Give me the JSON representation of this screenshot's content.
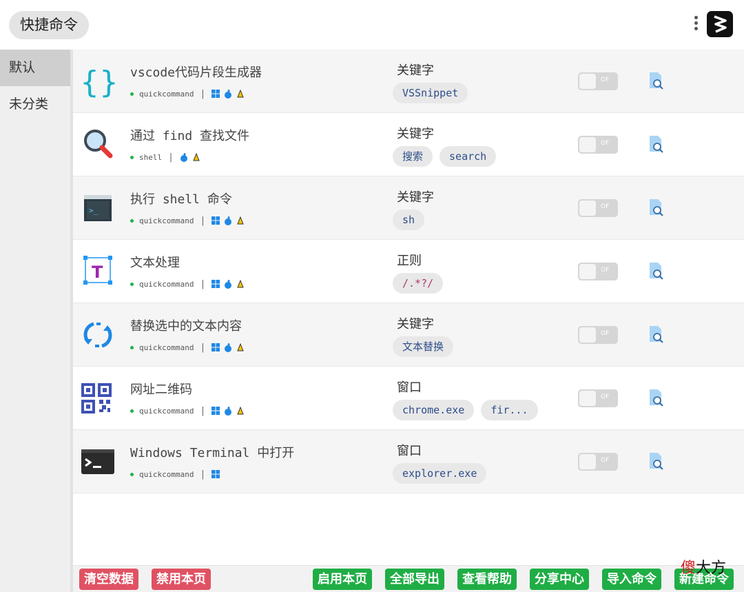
{
  "header": {
    "title": "快捷命令"
  },
  "sidebar": {
    "items": [
      {
        "label": "默认"
      },
      {
        "label": "未分类"
      }
    ]
  },
  "commands": [
    {
      "name": "vscode代码片段生成器",
      "source": "quickcommand",
      "platforms": [
        "windows",
        "apple",
        "linux"
      ],
      "icon": "braces-icon",
      "kw_label": "关键字",
      "tags": [
        "VSSnippet"
      ],
      "toggle": "OF"
    },
    {
      "name": "通过 find 查找文件",
      "source": "shell",
      "platforms": [
        "apple",
        "linux"
      ],
      "icon": "magnifier-icon",
      "kw_label": "关键字",
      "tags": [
        "搜索",
        "search"
      ],
      "toggle": "OF"
    },
    {
      "name": "执行 shell 命令",
      "source": "quickcommand",
      "platforms": [
        "windows",
        "apple",
        "linux"
      ],
      "icon": "terminal-window-icon",
      "kw_label": "关键字",
      "tags": [
        "sh"
      ],
      "toggle": "OF"
    },
    {
      "name": "文本处理",
      "source": "quickcommand",
      "platforms": [
        "windows",
        "apple",
        "linux"
      ],
      "icon": "text-box-icon",
      "kw_label": "正则",
      "tags": [
        "/.*?/"
      ],
      "toggle": "OF"
    },
    {
      "name": "替换选中的文本内容",
      "source": "quickcommand",
      "platforms": [
        "windows",
        "apple",
        "linux"
      ],
      "icon": "replace-arrows-icon",
      "kw_label": "关键字",
      "tags": [
        "文本替换"
      ],
      "toggle": "OF"
    },
    {
      "name": "网址二维码",
      "source": "quickcommand",
      "platforms": [
        "windows",
        "apple",
        "linux"
      ],
      "icon": "qr-code-icon",
      "kw_label": "窗口",
      "tags": [
        "chrome.exe",
        "fir..."
      ],
      "toggle": "OF"
    },
    {
      "name": "Windows Terminal 中打开",
      "source": "quickcommand",
      "platforms": [
        "windows"
      ],
      "icon": "terminal-prompt-icon",
      "kw_label": "窗口",
      "tags": [
        "explorer.exe"
      ],
      "toggle": "OF"
    }
  ],
  "footer": {
    "clear_data": "清空数据",
    "disable_page": "禁用本页",
    "enable_page": "启用本页",
    "export_all": "全部导出",
    "help": "查看帮助",
    "share_center": "分享中心",
    "import": "导入命令",
    "new": "新建命令"
  },
  "watermark": {
    "part1": "傻",
    "part2": "大方"
  },
  "colors": {
    "red_button": "#e05263",
    "green_button": "#1fad45",
    "tag_text": "#2d4d8a",
    "tag_bg": "#e8e8e8"
  }
}
